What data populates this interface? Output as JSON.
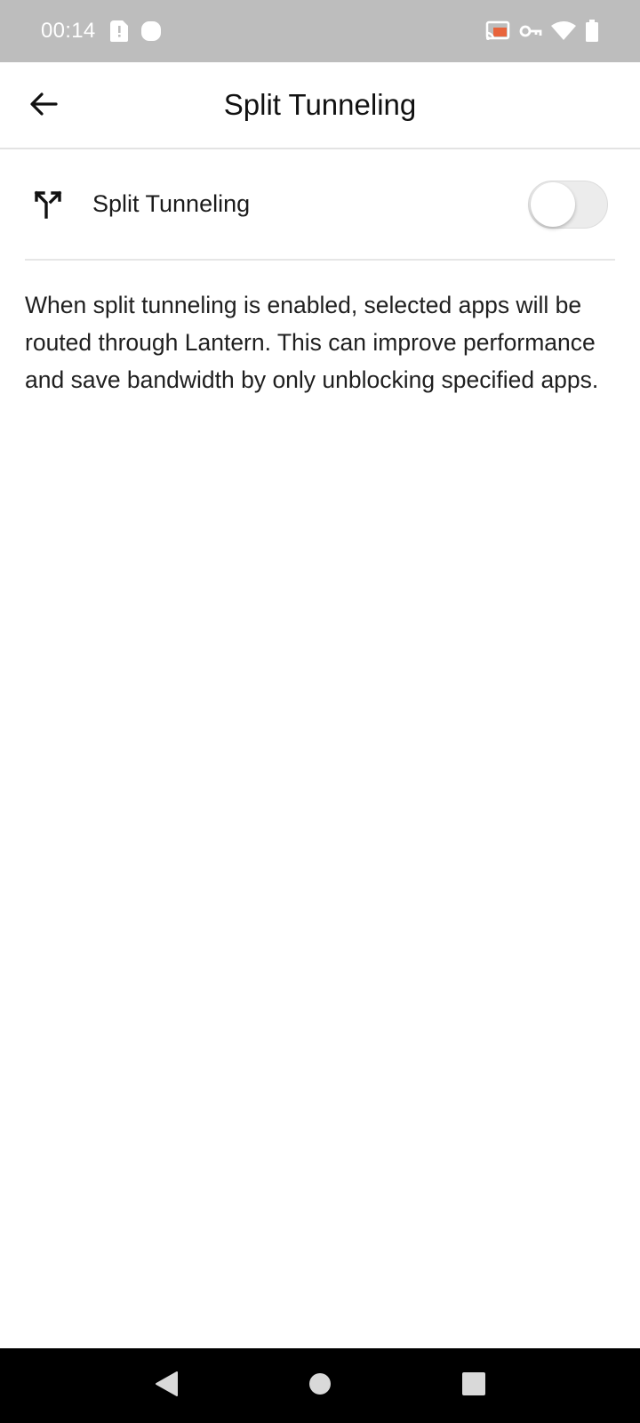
{
  "status_bar": {
    "time": "00:14",
    "left_icons": [
      "sim-alert-icon",
      "record-icon"
    ],
    "right_icons": [
      "cast-icon",
      "vpn-key-icon",
      "wifi-icon",
      "battery-icon"
    ],
    "cast_accent": "#e8643c"
  },
  "header": {
    "back_icon": "arrow-back-icon",
    "title": "Split Tunneling"
  },
  "setting": {
    "icon": "call-split-icon",
    "label": "Split Tunneling",
    "enabled": false
  },
  "description": "When split tunneling is enabled, selected apps will be routed through Lantern. This can improve performance and save bandwidth by only unblocking specified apps.",
  "nav_bar": {
    "buttons": [
      "back-triangle-icon",
      "home-circle-icon",
      "recents-square-icon"
    ]
  }
}
